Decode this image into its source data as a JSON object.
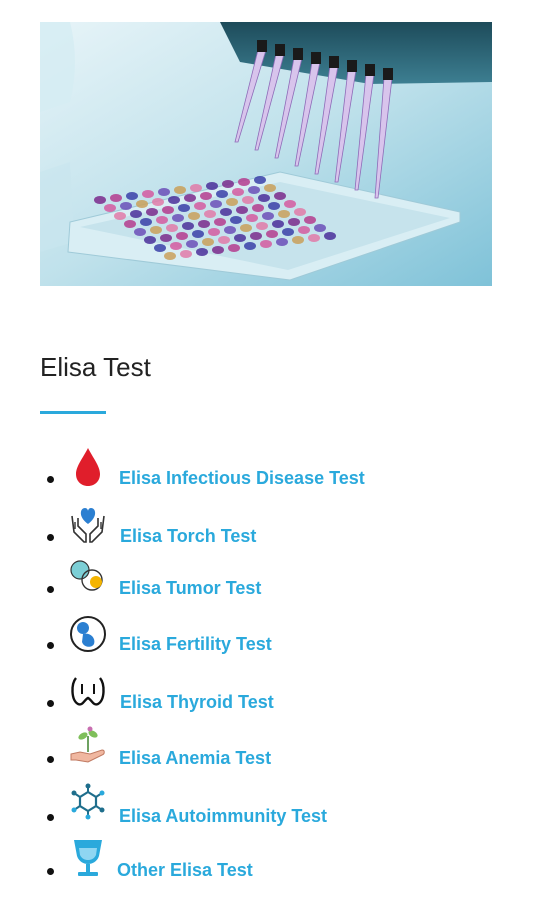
{
  "hero": {
    "alt": "Microplate being filled by a multichannel pipette"
  },
  "section": {
    "title": "Elisa Test"
  },
  "tests": [
    {
      "label": "Elisa Infectious Disease Test",
      "icon": "blood-drop-icon"
    },
    {
      "label": "Elisa Torch Test",
      "icon": "heart-hands-icon"
    },
    {
      "label": "Elisa Tumor Test",
      "icon": "tumor-cells-icon"
    },
    {
      "label": "Elisa Fertility Test",
      "icon": "fetus-icon"
    },
    {
      "label": "Elisa Thyroid Test",
      "icon": "thyroid-icon"
    },
    {
      "label": "Elisa Anemia Test",
      "icon": "plant-hand-icon"
    },
    {
      "label": "Elisa Autoimmunity Test",
      "icon": "molecule-icon"
    },
    {
      "label": "Other Elisa Test",
      "icon": "goblet-icon"
    }
  ],
  "colors": {
    "link": "#2aa9dc",
    "accent": "#2aa9dc",
    "drop": "#e01e2b",
    "heart": "#2b7fd1"
  }
}
